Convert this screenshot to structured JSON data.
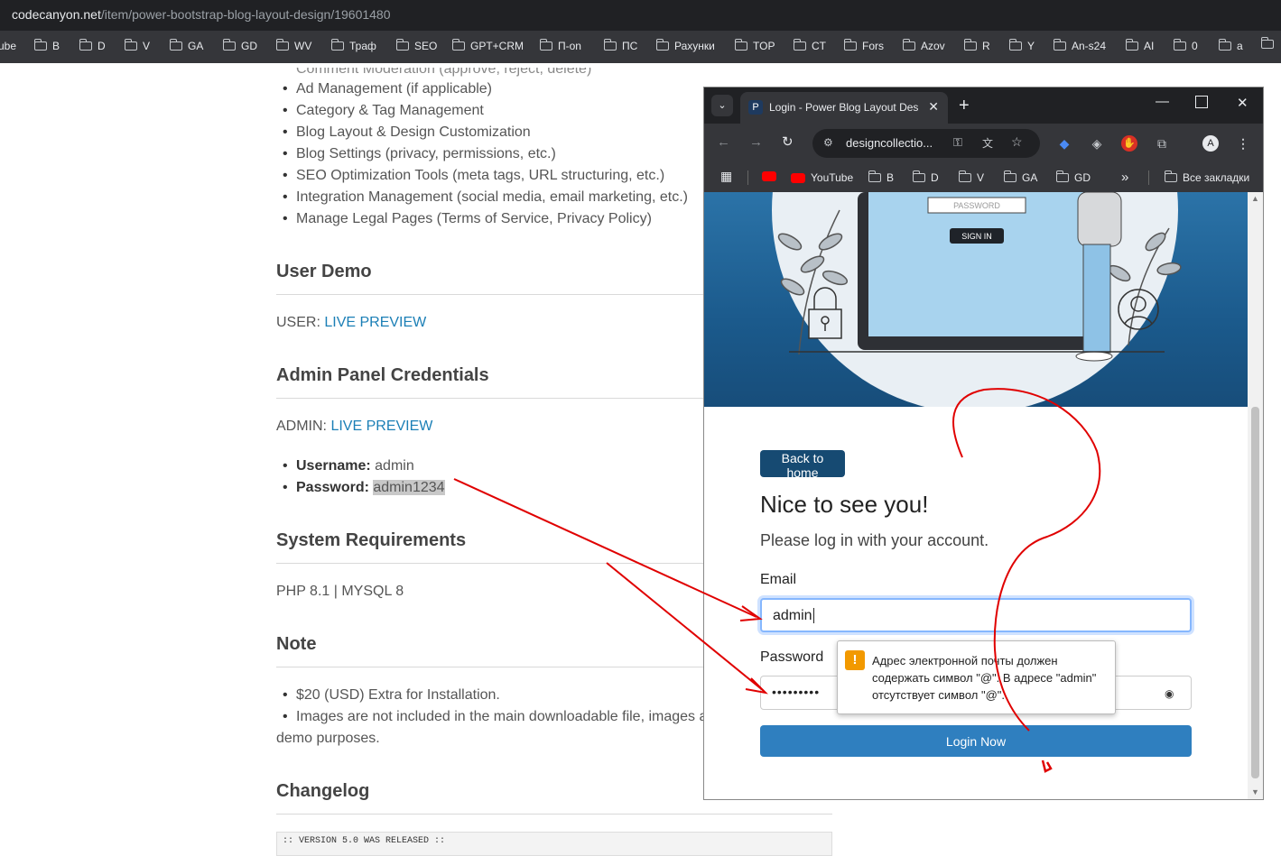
{
  "browser": {
    "url_host": "codecanyon.net",
    "url_path": "/item/power-bootstrap-blog-layout-design/19601480",
    "bookmarks": [
      "ube",
      "B",
      "D",
      "V",
      "GA",
      "GD",
      "WV",
      "Траф",
      "SEO",
      "GPT+CRM",
      "П-on",
      "ПС",
      "Рахунки",
      "TOP",
      "CT",
      "Fors",
      "Azov",
      "R",
      "Y",
      "An-s24",
      "AI",
      "0",
      "a"
    ]
  },
  "page": {
    "features": [
      "Comment Moderation (approve, reject, delete)",
      "Ad Management (if applicable)",
      "Category & Tag Management",
      "Blog Layout & Design Customization",
      "Blog Settings (privacy, permissions, etc.)",
      "SEO Optimization Tools (meta tags, URL structuring, etc.)",
      "Integration Management (social media, email marketing, etc.)",
      "Manage Legal Pages (Terms of Service, Privacy Policy)"
    ],
    "user_demo_heading": "User Demo",
    "user_prefix": "USER: ",
    "live_preview": "LIVE PREVIEW",
    "admin_heading": "Admin Panel Credentials",
    "admin_prefix": "ADMIN: ",
    "username_label": "Username:",
    "username_value": " admin",
    "password_label": "Password:",
    "password_value": "admin1234",
    "sysreq_heading": "System Requirements",
    "sysreq_text": "PHP 8.1 | MYSQL 8",
    "note_heading": "Note",
    "note_items": [
      "$20 (USD) Extra for Installation.",
      "Images are not included in the main downloadable file, images a"
    ],
    "note_cont": "demo purposes.",
    "changelog_heading": "Changelog",
    "changelog_text": ":: VERSION 5.0 WAS RELEASED ::"
  },
  "popup": {
    "tab_title": "Login - Power Blog Layout Desi",
    "omnibox_text": "designcollectio...",
    "bookmarks": [
      "YouTube",
      "B",
      "D",
      "V",
      "GA",
      "GD"
    ],
    "all_bookmarks": "Все закладки",
    "hero_password_placeholder": "PASSWORD",
    "hero_sign_in": "SIGN IN",
    "back_home": "Back to home",
    "greeting": "Nice to see you!",
    "subtitle": "Please log in with your account.",
    "email_label": "Email",
    "email_value": "admin",
    "password_label": "Password",
    "password_masked": "•••••••••",
    "login_button": "Login Now",
    "validation_message": "Адрес электронной почты должен содержать символ \"@\". В адресе \"admin\" отсутствует символ \"@\"."
  },
  "colors": {
    "link": "#1b7fb6",
    "brand_dark": "#164a72",
    "login_button": "#2f7fbf",
    "annotation": "#e00000",
    "warning": "#f29900"
  }
}
